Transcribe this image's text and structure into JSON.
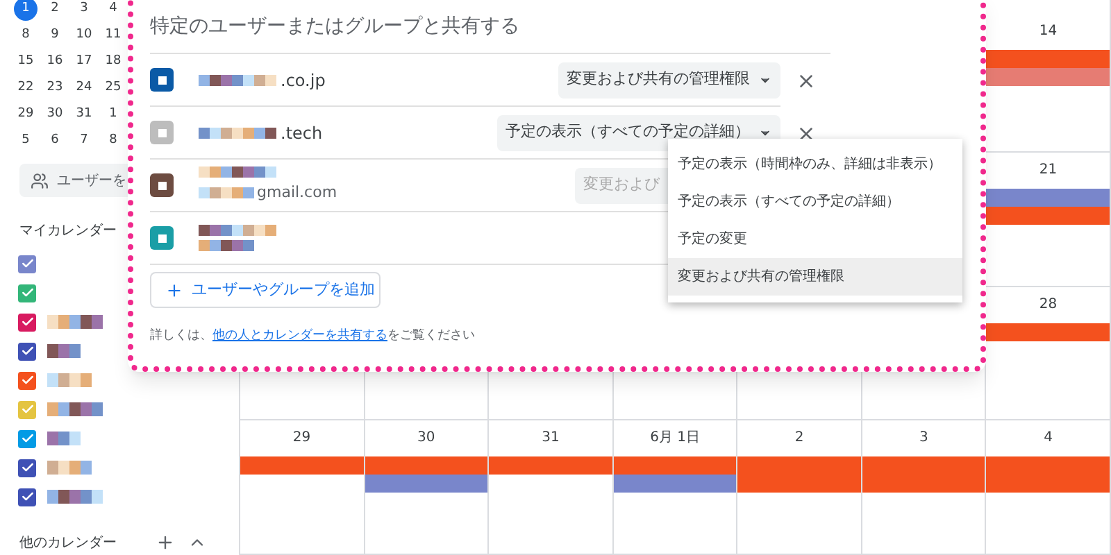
{
  "mini_calendar": {
    "weeks": [
      [
        {
          "day": "1",
          "selected": true
        },
        {
          "day": "2",
          "selected": false
        },
        {
          "day": "3",
          "selected": false
        },
        {
          "day": "4",
          "selected": false
        }
      ],
      [
        {
          "day": "8",
          "selected": false
        },
        {
          "day": "9",
          "selected": false
        },
        {
          "day": "10",
          "selected": false
        },
        {
          "day": "11",
          "selected": false
        }
      ],
      [
        {
          "day": "15",
          "selected": false
        },
        {
          "day": "16",
          "selected": false
        },
        {
          "day": "17",
          "selected": false
        },
        {
          "day": "18",
          "selected": false
        }
      ],
      [
        {
          "day": "22",
          "selected": false
        },
        {
          "day": "23",
          "selected": false
        },
        {
          "day": "24",
          "selected": false
        },
        {
          "day": "25",
          "selected": false
        }
      ],
      [
        {
          "day": "29",
          "selected": false
        },
        {
          "day": "30",
          "selected": false
        },
        {
          "day": "31",
          "selected": false
        },
        {
          "day": "1",
          "selected": false
        }
      ],
      [
        {
          "day": "5",
          "selected": false
        },
        {
          "day": "6",
          "selected": false
        },
        {
          "day": "7",
          "selected": false
        },
        {
          "day": "8",
          "selected": false
        }
      ]
    ]
  },
  "people_search": {
    "label": "ユーザーを"
  },
  "my_calendars": {
    "title": "マイカレンダー",
    "items": [
      {
        "color": "#7986cb",
        "checked": true
      },
      {
        "color": "#33b679",
        "checked": true
      },
      {
        "color": "#d81b60",
        "checked": true
      },
      {
        "color": "#3f51b5",
        "checked": true
      },
      {
        "color": "#f4511e",
        "checked": true
      },
      {
        "color": "#e4c441",
        "checked": true
      },
      {
        "color": "#039be5",
        "checked": true
      },
      {
        "color": "#3f51b5",
        "checked": true
      },
      {
        "color": "#3f51b5",
        "checked": true
      }
    ]
  },
  "other_calendars": {
    "title": "他のカレンダー"
  },
  "calendar": {
    "weeks": [
      {
        "days": [
          {
            "date": "14",
            "events": [
              {
                "color": "#f4511e"
              },
              {
                "color": "#e67c73"
              }
            ]
          }
        ]
      },
      {
        "days": [
          {
            "date": "21",
            "events": [
              {
                "color": "#7986cb"
              },
              {
                "color": "#f4511e"
              }
            ]
          }
        ]
      },
      {
        "days": [
          {
            "date": "28",
            "events": [
              {
                "color": "#f4511e"
              }
            ]
          }
        ]
      },
      {
        "days": [
          {
            "date": "29",
            "events": [
              {
                "color": "#f4511e"
              }
            ]
          },
          {
            "date": "30",
            "events": [
              {
                "color": "#f4511e"
              },
              {
                "color": "#7986cb"
              }
            ]
          },
          {
            "date": "31",
            "events": [
              {
                "color": "#f4511e"
              }
            ]
          },
          {
            "date": "6月 1日",
            "events": [
              {
                "color": "#f4511e"
              },
              {
                "color": "#7986cb"
              }
            ]
          },
          {
            "date": "2",
            "events": [
              {
                "color": "#f4511e"
              },
              {
                "color": "#f4511e"
              }
            ]
          },
          {
            "date": "3",
            "events": [
              {
                "color": "#f4511e"
              },
              {
                "color": "#f4511e"
              }
            ]
          },
          {
            "date": "4",
            "events": [
              {
                "color": "#f4511e"
              },
              {
                "color": "#f4511e"
              }
            ]
          }
        ]
      }
    ]
  },
  "share_dialog": {
    "title": "特定のユーザーまたはグループと共有する",
    "people": [
      {
        "name": ".co.jp",
        "permission": "変更および共有の管理権限",
        "disabled": false
      },
      {
        "name": ".tech",
        "permission": "予定の表示（すべての予定の詳細）",
        "disabled": false
      },
      {
        "email": "gmail.com",
        "permission": "変更および",
        "disabled": true
      },
      {
        "kind": "group"
      }
    ],
    "add_button": "ユーザーやグループを追加",
    "footer": {
      "before": "詳しくは、",
      "link": "他の人とカレンダーを共有する",
      "after": "をご覧ください"
    }
  },
  "permission_menu": {
    "items": [
      {
        "label": "予定の表示（時間枠のみ、詳細は非表示）",
        "highlighted": false
      },
      {
        "label": "予定の表示（すべての予定の詳細）",
        "highlighted": false
      },
      {
        "label": "予定の変更",
        "highlighted": false
      },
      {
        "label": "変更および共有の管理権限",
        "highlighted": true
      }
    ]
  }
}
